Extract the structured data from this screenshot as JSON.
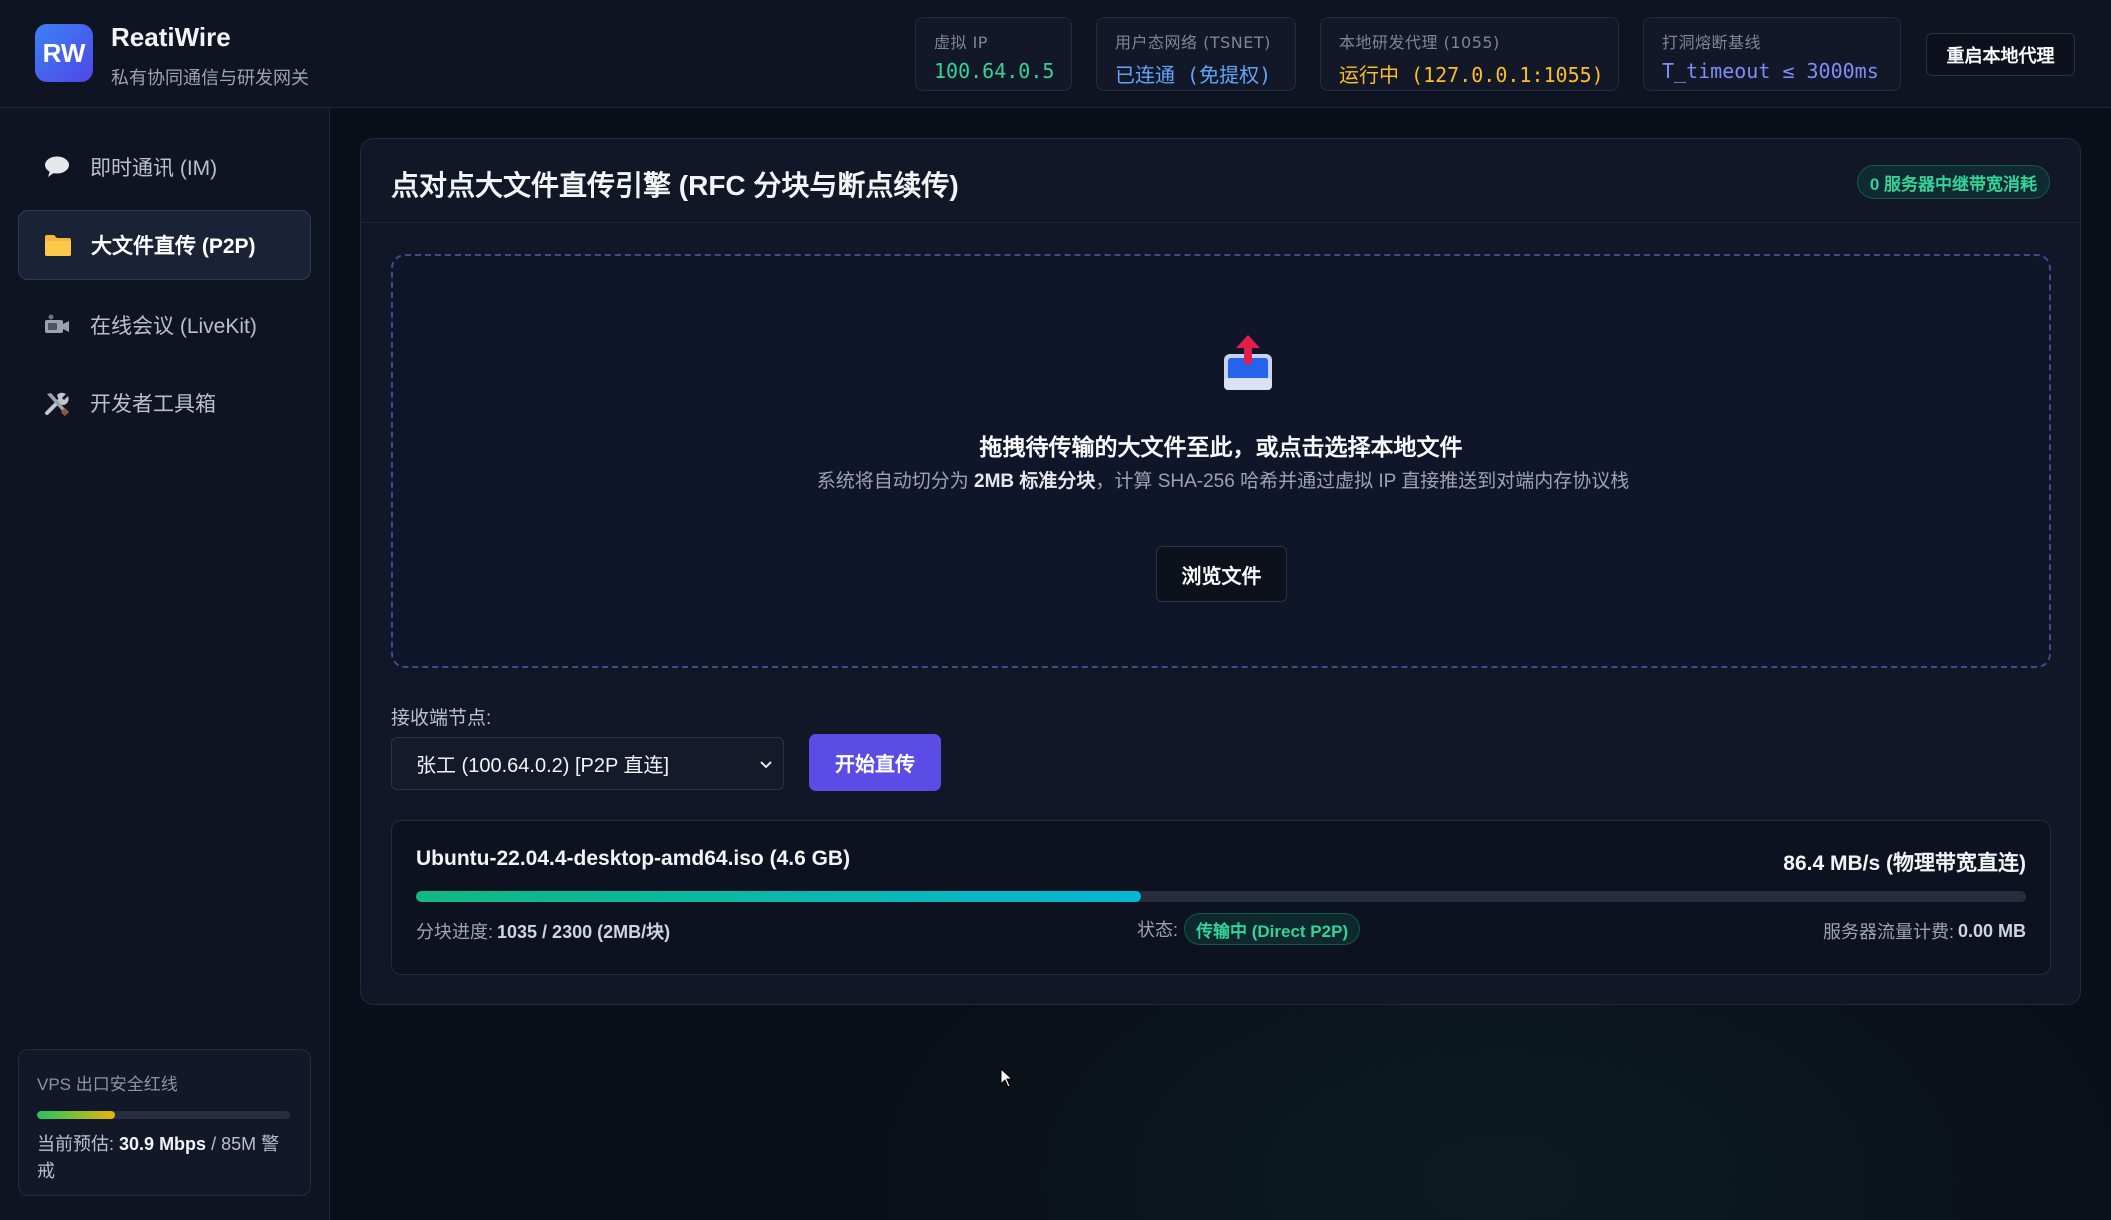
{
  "app": {
    "logo_text": "RW",
    "name": "ReatiWire",
    "subtitle": "私有协同通信与研发网关"
  },
  "header": {
    "stats": [
      {
        "label": "虚拟 IP",
        "value": "100.64.0.5",
        "color": "#34d399"
      },
      {
        "label": "用户态网络 (TSNET)",
        "value": "已连通 (免提权)",
        "color": "#60a5fa"
      },
      {
        "label": "本地研发代理 (1055)",
        "value": "运行中 (127.0.0.1:1055)",
        "color": "#fbbf24"
      },
      {
        "label": "打洞熔断基线",
        "value": "T_timeout ≤ 3000ms",
        "color": "#818cf8"
      }
    ],
    "restart_label": "重启本地代理"
  },
  "sidebar": {
    "items": [
      {
        "label": "即时通讯 (IM)",
        "icon": "speech-bubble-icon",
        "active": false
      },
      {
        "label": "大文件直传 (P2P)",
        "icon": "folder-icon",
        "active": true
      },
      {
        "label": "在线会议 (LiveKit)",
        "icon": "video-camera-icon",
        "active": false
      },
      {
        "label": "开发者工具箱",
        "icon": "tools-icon",
        "active": false
      }
    ],
    "vps": {
      "title": "VPS 出口安全红线",
      "usage_fraction": 0.31,
      "current_label": "当前预估:",
      "current_value": "30.9 Mbps",
      "limit_text": "/ 85M 警戒"
    }
  },
  "panel": {
    "title": "点对点大文件直传引擎 (RFC 分块与断点续传)",
    "badge": "0 服务器中继带宽消耗",
    "dropzone": {
      "icon": "upload-tray-icon",
      "title": "拖拽待传输的大文件至此，或点击选择本地文件",
      "desc_pre": "系统将自动切分为 ",
      "desc_bold": "2MB 标准分块",
      "desc_post": "，计算 SHA-256 哈希并通过虚拟 IP 直接推送到对端内存协议栈",
      "browse_label": "浏览文件"
    },
    "receiver": {
      "label": "接收端节点:",
      "selected": "张工 (100.64.0.2) [P2P 直连]",
      "start_label": "开始直传"
    },
    "transfer": {
      "file": "Ubuntu-22.04.4-desktop-amd64.iso (4.6 GB)",
      "speed": "86.4 MB/s (物理带宽直连)",
      "progress_fraction": 0.45,
      "chunk_label": "分块进度:",
      "chunk_value": "1035 / 2300 (2MB/块)",
      "status_label": "状态:",
      "status_value": "传输中 (Direct P2P)",
      "server_label": "服务器流量计费:",
      "server_value": "0.00 MB"
    }
  }
}
